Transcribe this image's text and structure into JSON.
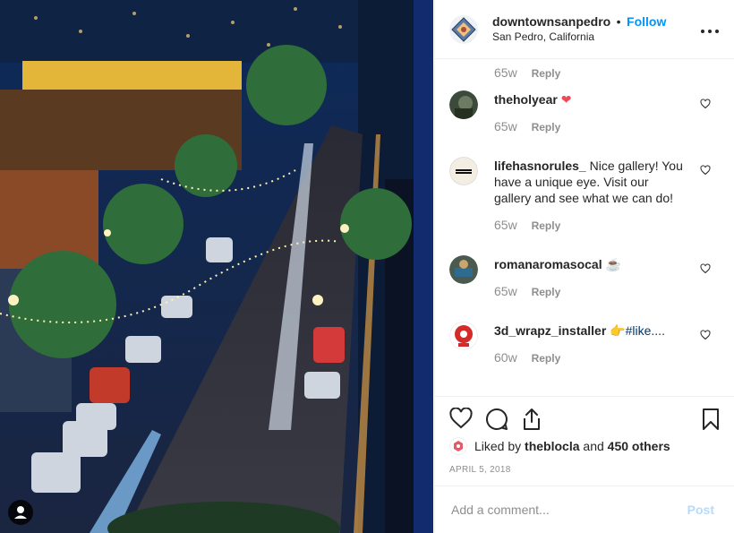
{
  "header": {
    "username": "downtownsanpedro",
    "separator": "•",
    "follow_label": "Follow",
    "location": "San Pedro, California",
    "more_icon": "more-horizontal-icon"
  },
  "comments": {
    "first_meta": {
      "time": "65w",
      "reply": "Reply"
    },
    "items": [
      {
        "username": "theholyear",
        "text": "",
        "emoji": "❤",
        "time": "65w",
        "reply": "Reply"
      },
      {
        "username": "lifehasnorules_",
        "text": "Nice gallery! You have a unique eye. Visit our gallery and see what we can do!",
        "emoji": "",
        "time": "65w",
        "reply": "Reply"
      },
      {
        "username": "romanaromasocal",
        "text": "",
        "emoji": "☕",
        "time": "65w",
        "reply": "Reply"
      },
      {
        "username": "3d_wrapz_installer",
        "text": "👉#like....",
        "emoji": "",
        "time": "60w",
        "reply": "Reply"
      }
    ]
  },
  "actions": {
    "like_icon": "heart-icon",
    "comment_icon": "comment-icon",
    "share_icon": "share-icon",
    "save_icon": "bookmark-icon"
  },
  "likes": {
    "prefix": "Liked by",
    "user": "theblocla",
    "and": "and",
    "others": "450 others"
  },
  "date": "APRIL 5, 2018",
  "add_comment": {
    "placeholder": "Add a comment...",
    "post_label": "Post"
  },
  "colors": {
    "link_blue": "#0095f6",
    "heart_red": "#ed4956",
    "muted": "#8e8e8e",
    "post_disabled": "#b3dbff"
  }
}
